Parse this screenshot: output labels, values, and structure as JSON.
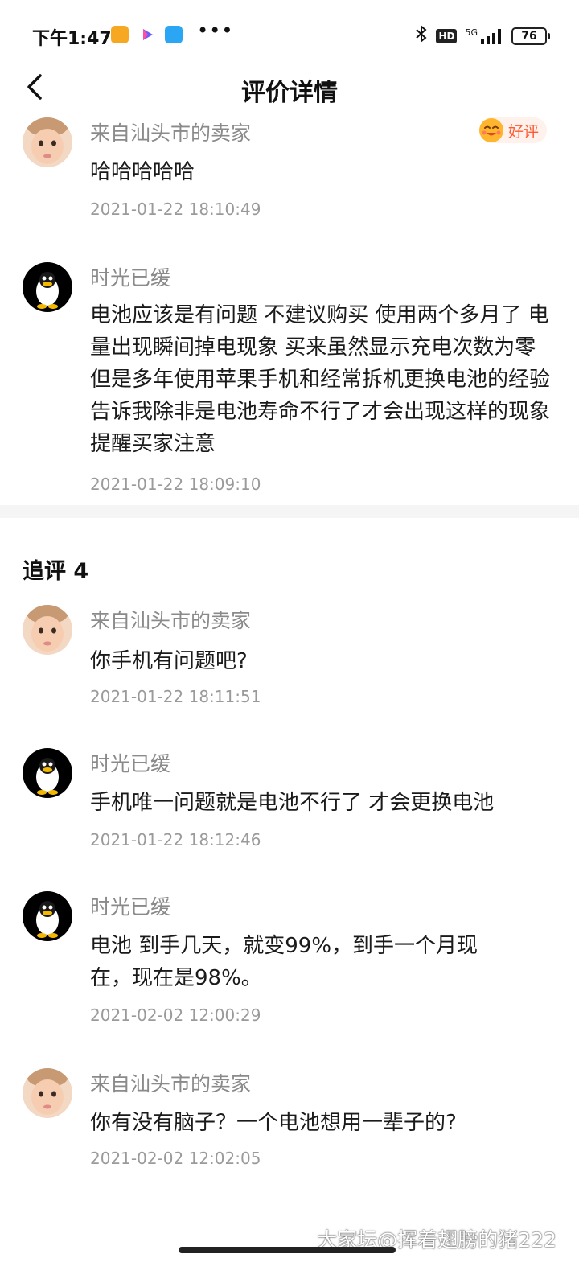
{
  "status_bar": {
    "time": "下午1:47",
    "dots": "•••",
    "bluetooth_icon": "bluetooth-icon",
    "hd_label": "HD",
    "signal_label": "5G",
    "battery": "76"
  },
  "header": {
    "title": "评价详情",
    "back_icon": "chevron-left-icon"
  },
  "review": {
    "reply": {
      "name": "来自汕头市的卖家",
      "content": "哈哈哈哈哈",
      "time": "2021-01-22 18:10:49",
      "badge": "好评"
    },
    "main": {
      "name": "时光已缓",
      "content": "电池应该是有问题 不建议购买 使用两个多月了 电量出现瞬间掉电现象 买来虽然显示充电次数为零 但是多年使用苹果手机和经常拆机更换电池的经验告诉我除非是电池寿命不行了才会出现这样的现象 提醒买家注意",
      "time": "2021-01-22 18:09:10"
    }
  },
  "follow_ups": {
    "title": "追评 4",
    "items": [
      {
        "name": "来自汕头市的卖家",
        "content": "你手机有问题吧?",
        "time": "2021-01-22 18:11:51"
      },
      {
        "name": "时光已缓",
        "content": "手机唯一问题就是电池不行了 才会更换电池",
        "time": "2021-01-22 18:12:46"
      },
      {
        "name": "时光已缓",
        "content": "电池 到手几天，就变99%，到手一个月现在，现在是98%。",
        "time": "2021-02-02 12:00:29"
      },
      {
        "name": "来自汕头市的卖家",
        "content": "你有没有脑子？一个电池想用一辈子的?",
        "time": "2021-02-02 12:02:05"
      }
    ]
  },
  "watermark": "大家坛@挥着翅膀的猪222",
  "colors": {
    "badge_text": "#ff5a32",
    "badge_bg": "#fff1ec",
    "secondary_text": "#8a8a8a"
  }
}
